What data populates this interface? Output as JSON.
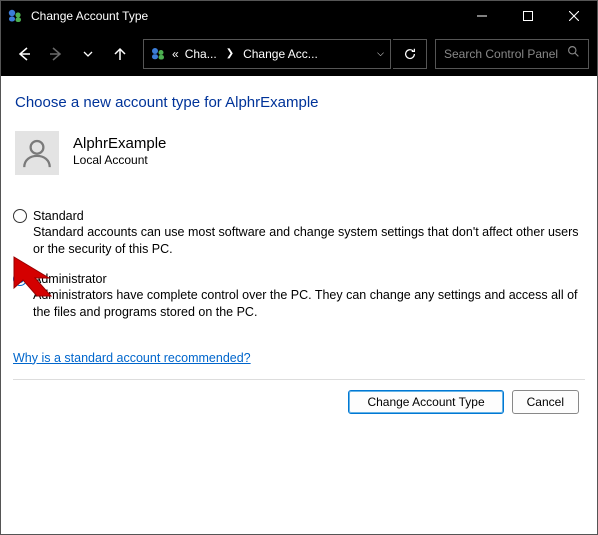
{
  "window": {
    "title": "Change Account Type"
  },
  "navbar": {
    "crumb_prefix": "«",
    "crumb1": "Cha...",
    "crumb2": "Change Acc...",
    "search_placeholder": "Search Control Panel"
  },
  "page": {
    "heading": "Choose a new account type for AlphrExample",
    "user": {
      "name": "AlphrExample",
      "type": "Local Account"
    },
    "options": {
      "standard": {
        "label": "Standard",
        "desc": "Standard accounts can use most software and change system settings that don't affect other users or the security of this PC."
      },
      "admin": {
        "label": "Administrator",
        "desc": "Administrators have complete control over the PC. They can change any settings and access all of the files and programs stored on the PC."
      }
    },
    "link": "Why is a standard account recommended?",
    "buttons": {
      "change": "Change Account Type",
      "cancel": "Cancel"
    }
  }
}
